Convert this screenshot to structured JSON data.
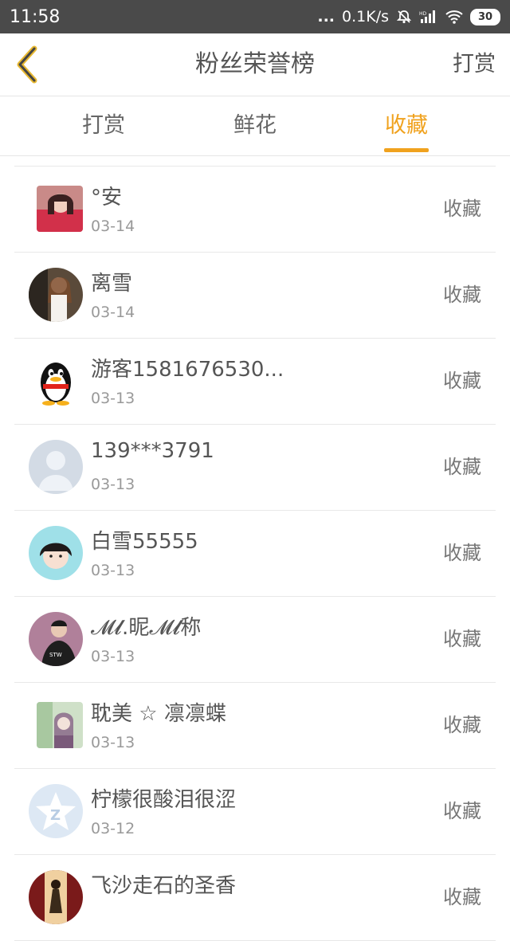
{
  "status": {
    "time": "11:58",
    "dots": "...",
    "speed": "0.1K/s",
    "battery": "30"
  },
  "header": {
    "title": "粉丝荣誉榜",
    "action": "打赏"
  },
  "tabs": [
    {
      "label": "打赏"
    },
    {
      "label": "鲜花"
    },
    {
      "label": "收藏"
    }
  ],
  "active_tab": "收藏",
  "accent_color": "#f0a21e",
  "list": [
    {
      "name": "°安",
      "date": "03-14",
      "action": "收藏",
      "avatar": "photo-girl-red"
    },
    {
      "name": "离雪",
      "date": "03-14",
      "action": "收藏",
      "avatar": "photo-girl-outdoor"
    },
    {
      "name": "游客1581676530...",
      "date": "03-13",
      "action": "收藏",
      "avatar": "qq-penguin"
    },
    {
      "name": "139***3791",
      "date": "03-13",
      "action": "收藏",
      "avatar": "default-user"
    },
    {
      "name": "白雪55555",
      "date": "03-13",
      "action": "收藏",
      "avatar": "photo-girl-selfie"
    },
    {
      "name": "𝓜𝓵.昵𝓜𝓵称",
      "date": "03-13",
      "action": "收藏",
      "avatar": "photo-boy"
    },
    {
      "name": "耽美 ☆ 凛凛蝶",
      "date": "03-13",
      "action": "收藏",
      "avatar": "photo-girl-pale"
    },
    {
      "name": "柠檬很酸泪很涩",
      "date": "03-12",
      "action": "收藏",
      "avatar": "qzone-star"
    },
    {
      "name": "飞沙走石的圣香",
      "date": "",
      "action": "收藏",
      "avatar": "photo-stage"
    }
  ]
}
